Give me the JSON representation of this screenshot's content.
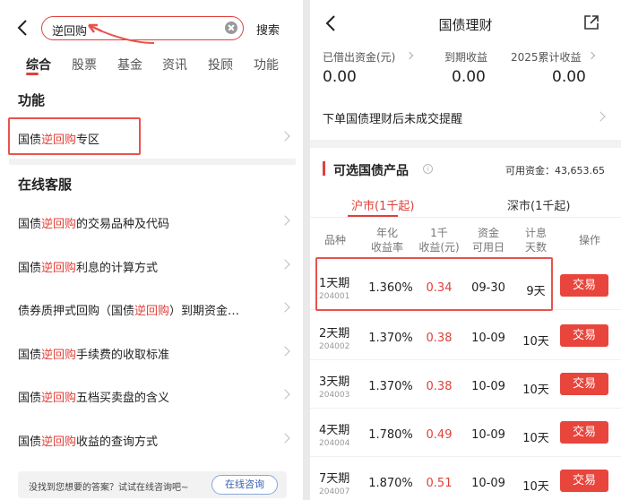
{
  "left": {
    "search": {
      "query": "逆回购",
      "button": "搜索"
    },
    "categories": [
      "综合",
      "股票",
      "基金",
      "资讯",
      "投顾",
      "功能"
    ],
    "section_function": "功能",
    "function_item": {
      "pre": "国债",
      "hl": "逆回购",
      "post": "专区"
    },
    "section_service": "在线客服",
    "service_items": [
      {
        "pre": "国债",
        "hl": "逆回购",
        "post": "的交易品种及代码"
      },
      {
        "pre": "国债",
        "hl": "逆回购",
        "post": "利息的计算方式"
      },
      {
        "pre": "债券质押式回购（国债",
        "hl": "逆回购",
        "post": "）到期资金…"
      },
      {
        "pre": "国债",
        "hl": "逆回购",
        "post": "手续费的收取标准"
      },
      {
        "pre": "国债",
        "hl": "逆回购",
        "post": "五档买卖盘的含义"
      },
      {
        "pre": "国债",
        "hl": "逆回购",
        "post": "收益的查询方式"
      }
    ],
    "bottom_prompt": "没找到您想要的答案？试试在线咨询吧~",
    "consult_button": "在线咨询"
  },
  "right": {
    "title": "国债理财",
    "stats": [
      {
        "label": "已借出资金(元)",
        "value": "0.00"
      },
      {
        "label": "到期收益",
        "value": "0.00"
      },
      {
        "label": "2025累计收益",
        "value": "0.00"
      }
    ],
    "pending_label": "下单国债理财后未成交提醒",
    "products_title": "可选国债产品",
    "available_funds": "可用资金：43,653.65",
    "market_tabs": [
      "沪市(1千起)",
      "深市(1千起)"
    ],
    "headers": [
      [
        "品种"
      ],
      [
        "年化",
        "收益率"
      ],
      [
        "1千",
        "收益(元)"
      ],
      [
        "资金",
        "可用日"
      ],
      [
        "计息",
        "天数"
      ],
      [
        "操作"
      ]
    ],
    "trade_label": "交易",
    "products": [
      {
        "name": "1天期",
        "code": "204001",
        "rate": "1.360%",
        "income": "0.34",
        "date": "09-30",
        "days": "9天"
      },
      {
        "name": "2天期",
        "code": "204002",
        "rate": "1.370%",
        "income": "0.38",
        "date": "10-09",
        "days": "10天"
      },
      {
        "name": "3天期",
        "code": "204003",
        "rate": "1.370%",
        "income": "0.38",
        "date": "10-09",
        "days": "10天"
      },
      {
        "name": "4天期",
        "code": "204004",
        "rate": "1.780%",
        "income": "0.49",
        "date": "10-09",
        "days": "10天"
      },
      {
        "name": "7天期",
        "code": "204007",
        "rate": "1.870%",
        "income": "0.51",
        "date": "10-09",
        "days": "10天"
      }
    ]
  },
  "colors": {
    "accent": "#e0403a",
    "annotation": "#e8534d",
    "trade_button": "#e8453c"
  }
}
